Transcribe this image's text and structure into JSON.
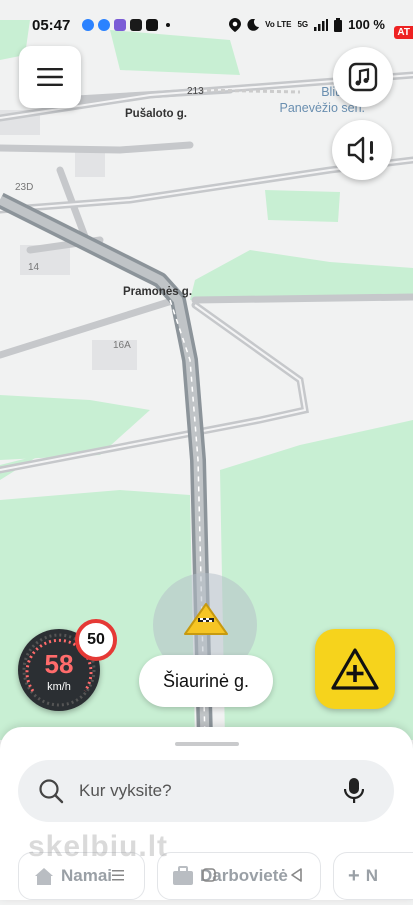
{
  "status_bar": {
    "time": "05:47",
    "battery": "100 %",
    "network": "5G",
    "volte": "Vo LTE",
    "carrier_badge": "AT",
    "app_icons": [
      "messenger-icon",
      "messenger-icon",
      "viber-icon",
      "tv-icon",
      "tiktok-icon",
      "dot-icon"
    ],
    "system_icons": [
      "location-icon",
      "moon-icon",
      "volte-icon",
      "signal-icon",
      "battery-icon"
    ]
  },
  "map": {
    "labels": {
      "pusaloto": "Pušaloto g.",
      "road_213": "213",
      "bliudziai": "Bliūdžia",
      "panevezio": "Panevėžio sen.",
      "bld_23d": "23D",
      "bld_14": "14",
      "pramones": "Pramonės g.",
      "bld_16a": "16A"
    },
    "colors": {
      "land": "#f1f2f2",
      "park": "#c8efd3",
      "road": "#9aa0a6",
      "route": "#7e868c"
    }
  },
  "controls": {
    "menu_icon": "hamburger-menu-icon",
    "music_icon": "music-note-icon",
    "sound_icon": "speaker-alert-icon"
  },
  "speedometer": {
    "speed": "58",
    "unit": "km/h",
    "limit": "50",
    "speed_color": "#ff6b6b"
  },
  "current_street": "Šiaurinė g.",
  "report_button": {
    "icon": "warning-plus-icon",
    "color": "#f6d31c"
  },
  "bottom_sheet": {
    "search_placeholder": "Kur vyksite?",
    "chips": [
      {
        "label": "Namai",
        "icon": "home-icon"
      },
      {
        "label": "Darbovietė",
        "icon": "briefcase-icon"
      },
      {
        "label": "N",
        "icon": "plus-icon"
      }
    ],
    "watermark": "skelbiu.lt"
  }
}
